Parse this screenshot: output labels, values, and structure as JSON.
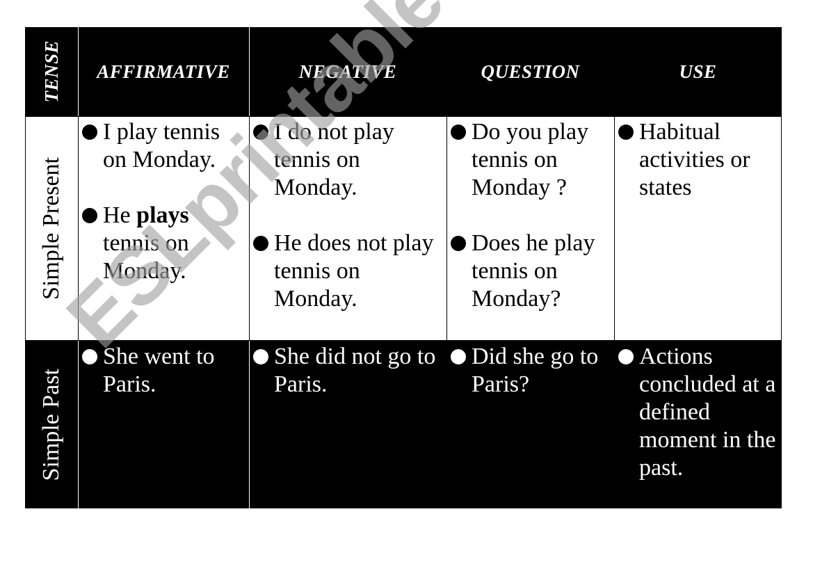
{
  "header": {
    "tense": "TENSE",
    "affirmative": "AFFIRMATIVE",
    "negative": "NEGATIVE",
    "question": "QUESTION",
    "use": "USE"
  },
  "rows": [
    {
      "tense": "Simple Present",
      "affirmative": [
        {
          "pre": "I play tennis on Monday.",
          "bold": "",
          "post": ""
        },
        {
          "pre": "He ",
          "bold": "plays",
          "post": " tennis on Monday."
        }
      ],
      "negative": [
        "I do not play tennis on Monday.",
        "He does not play tennis on Monday."
      ],
      "question": [
        "Do you play tennis on Monday ?",
        "Does he play tennis on Monday?"
      ],
      "use": [
        "Habitual activities or states"
      ]
    },
    {
      "tense": "Simple Past",
      "affirmative": [
        {
          "pre": "She went to Paris.",
          "bold": "",
          "post": ""
        }
      ],
      "negative": [
        "She did not go to Paris."
      ],
      "question": [
        "Did she go to Paris?"
      ],
      "use": [
        "Actions concluded at a defined moment in the past."
      ]
    }
  ],
  "watermark": "ESLprintables.com",
  "colors": {
    "dark": "#000000",
    "light": "#ffffff",
    "watermark": "#a0a0a0"
  }
}
